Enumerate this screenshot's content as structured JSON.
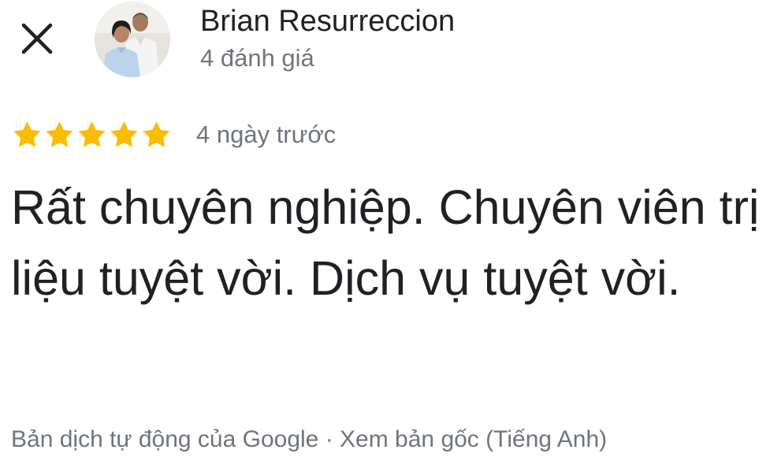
{
  "header": {
    "close_icon": "close-icon",
    "reviewer_name": "Brian Resurreccion",
    "review_count": "4 đánh giá"
  },
  "review": {
    "rating": 5,
    "rating_max": 5,
    "time_ago": "4 ngày trước",
    "text": "Rất chuyên nghiệp. Chuyên viên trị liệu tuyệt vời. Dịch vụ tuyệt vời."
  },
  "footer": {
    "translation_note": "Bản dịch tự động của Google",
    "separator": " · ",
    "view_original": "Xem bản gốc (Tiếng Anh)"
  },
  "colors": {
    "star": "#FBBC04",
    "primary_text": "#202124",
    "secondary_text": "#70757A"
  }
}
